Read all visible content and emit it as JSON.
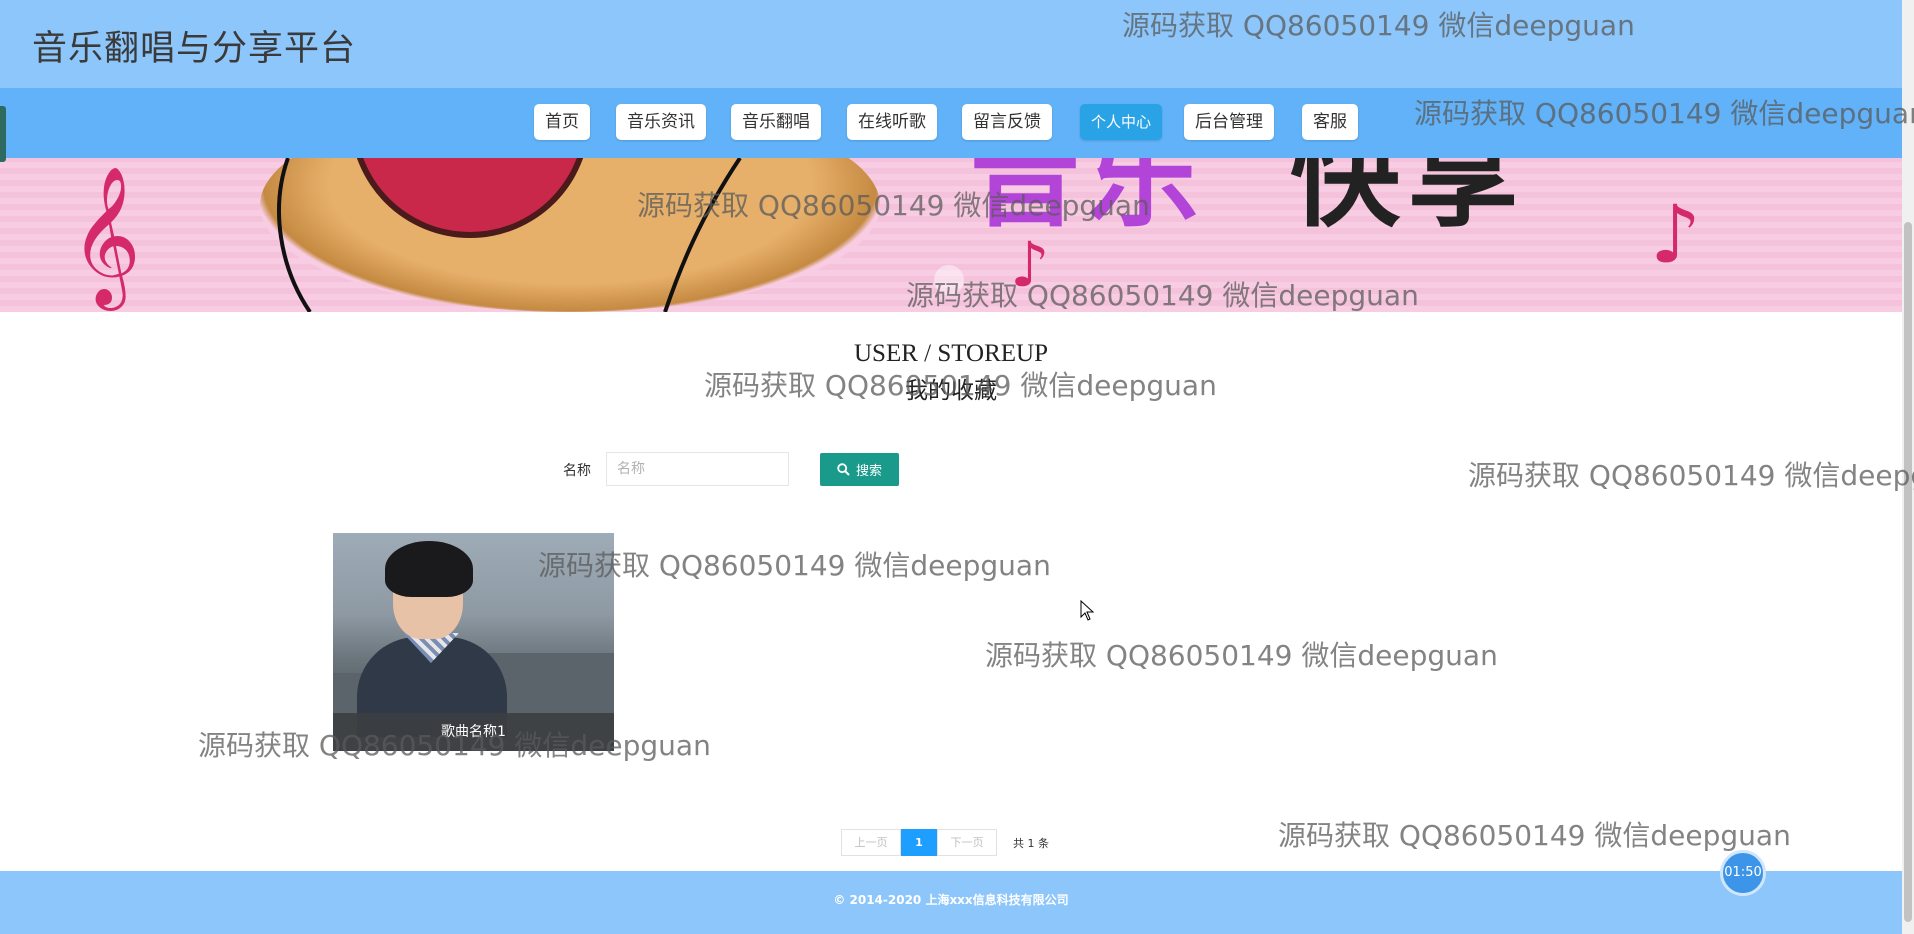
{
  "site_title": "音乐翻唱与分享平台",
  "nav": {
    "items": [
      {
        "label": "首页"
      },
      {
        "label": "音乐资讯"
      },
      {
        "label": "音乐翻唱"
      },
      {
        "label": "在线听歌"
      },
      {
        "label": "留言反馈"
      },
      {
        "label": "个人中心"
      },
      {
        "label": "后台管理"
      },
      {
        "label": "客服"
      }
    ],
    "active_index": 5
  },
  "section": {
    "title_en": "USER / STOREUP",
    "title_cn": "我的收藏"
  },
  "search": {
    "label": "名称",
    "placeholder": "名称",
    "value": "",
    "button_label": "搜索"
  },
  "items": [
    {
      "caption": "歌曲名称1"
    }
  ],
  "pagination": {
    "prev": "上一页",
    "current": "1",
    "next": "下一页",
    "total": "共 1 条"
  },
  "footer": {
    "copyright": "© 2014-2020 上海xxx信息科技有限公司"
  },
  "timer": "01:50",
  "watermark": "源码获取 QQ86050149 微信deepguan",
  "colors": {
    "header_bg": "#8dc6fb",
    "nav_bg": "#61b2f8",
    "active_nav": "#2aa3e6",
    "search_button": "#199a8a",
    "pager_active": "#1e9fff"
  }
}
